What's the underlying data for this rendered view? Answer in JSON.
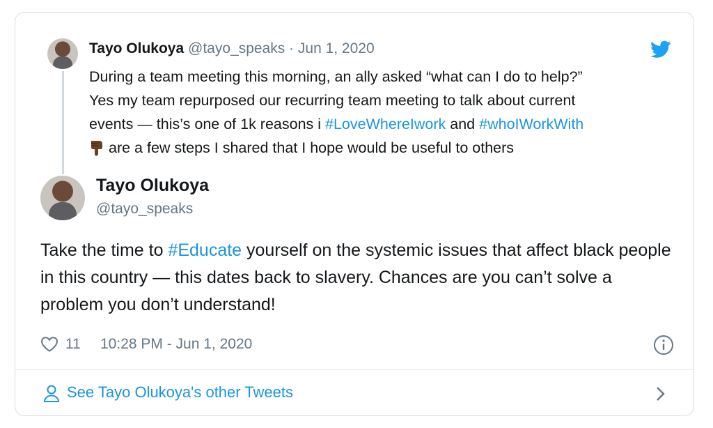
{
  "parent_tweet": {
    "name": "Tayo Olukoya",
    "meta": "@tayo_speaks · Jun 1, 2020",
    "line1": "During a team meeting this morning, an ally asked “what can I do to help?”",
    "line2": "Yes my team repurposed our recurring team meeting to talk about current",
    "line3_a": "events — this’s one of 1k reasons i ",
    "hashtag1": "#LoveWhereIwork",
    "line3_b": " and ",
    "hashtag2": "#whoIWorkWith",
    "line4": "are a few steps I shared that I hope would be useful to others"
  },
  "main_tweet": {
    "name": "Tayo Olukoya",
    "handle": "@tayo_speaks",
    "text_a": "Take the time to ",
    "hashtag": "#Educate",
    "text_b": " yourself on the systemic issues that affect black people in this country — this dates back to slavery. Chances are you can’t solve a problem you don’t understand!",
    "likes": "11",
    "timestamp": "10:28 PM - Jun 1, 2020"
  },
  "footer": {
    "see_more": "See Tayo Olukoya's other Tweets"
  },
  "colors": {
    "accent": "#1b95e0",
    "muted": "#657786",
    "text": "#14171a"
  },
  "icons": [
    "twitter-bird-icon",
    "pointing-down-icon",
    "heart-icon",
    "info-icon",
    "person-icon",
    "chevron-right-icon"
  ]
}
